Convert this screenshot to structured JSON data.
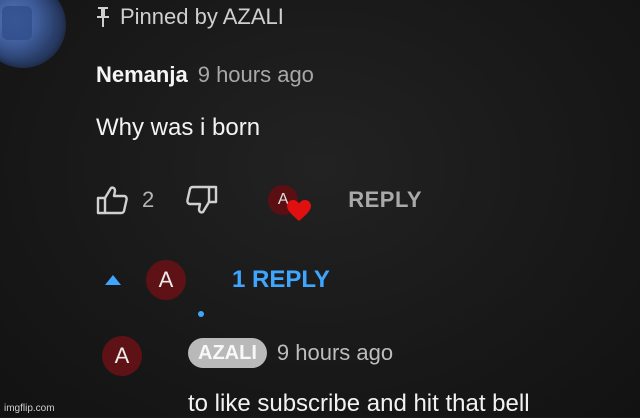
{
  "pinned": {
    "label": "Pinned by AZALI",
    "icon": "pin-icon"
  },
  "comment": {
    "author": "Nemanja",
    "time": "9 hours ago",
    "text": "Why was i born",
    "avatar_icon": "profile-avatar"
  },
  "actions": {
    "like_icon": "thumbs-up-icon",
    "like_count": "2",
    "dislike_icon": "thumbs-down-icon",
    "hearted_avatar_letter": "A",
    "heart_icon": "heart-icon",
    "reply_label": "REPLY"
  },
  "replies": {
    "toggle_icon": "caret-up-icon",
    "avatar_letter": "A",
    "count_label": "1 REPLY"
  },
  "reply": {
    "avatar_letter": "A",
    "author": "AZALI",
    "time": "9 hours ago",
    "text": "to like subscribe and hit that bell"
  },
  "watermark": "imgflip.com",
  "colors": {
    "background": "#181818",
    "link_blue": "#3ea6ff",
    "avatar_red": "#5e1215",
    "heart_red": "#e01010"
  }
}
